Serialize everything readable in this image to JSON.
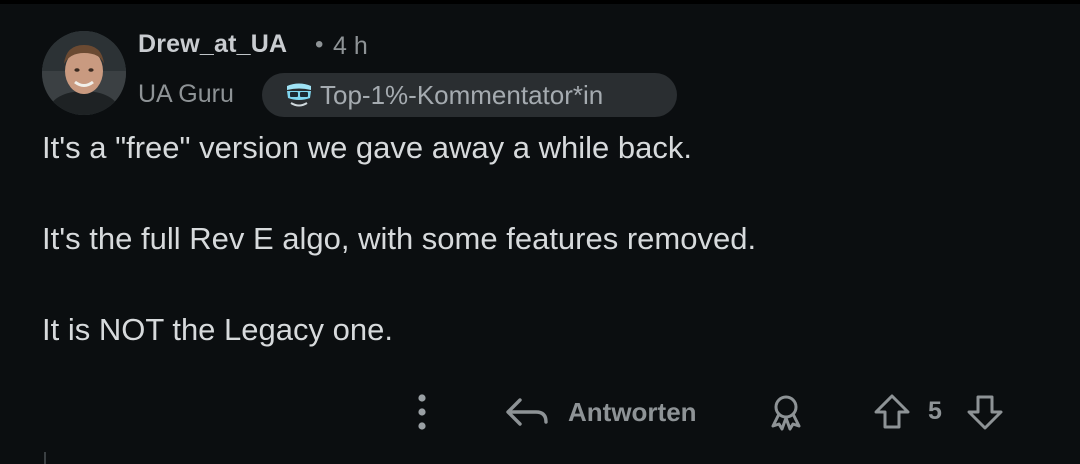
{
  "comment": {
    "author": "Drew_at_UA",
    "separator": "•",
    "time": "4 h",
    "flair": "UA Guru",
    "badge": "Top-1%-Kommentator*in",
    "paragraphs": [
      "It's a \"free\" version we gave away a while back.",
      "It's the full Rev E algo, with some features removed.",
      "It is NOT the Legacy one."
    ]
  },
  "actions": {
    "reply_label": "Antworten",
    "score": "5"
  },
  "icons": {
    "more": "more-vertical-icon",
    "reply": "reply-arrow-icon",
    "award": "award-icon",
    "upvote": "upvote-arrow-icon",
    "downvote": "downvote-arrow-icon",
    "badge": "top-commenter-badge-icon"
  },
  "colors": {
    "background": "#0b0e10",
    "text": "#d7dadc",
    "muted": "#8e9396",
    "badge_bg": "#2a2e31",
    "badge_accent": "#7fd6f0"
  }
}
